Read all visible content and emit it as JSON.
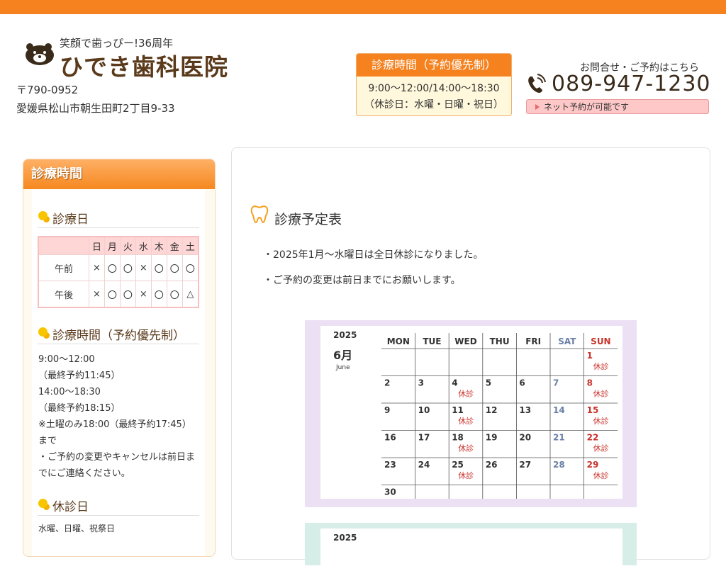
{
  "header": {
    "tagline": "笑顔で歯っぴー!36周年",
    "clinic_name": "ひでき歯科医院",
    "postal": "〒790-0952",
    "address": "愛媛県松山市朝生田町2丁目9-33",
    "hours_title": "診療時間（予約優先制）",
    "hours_line": "9:00〜12:00/14:00〜18:30",
    "closed_line": "（休診日：水曜・日曜・祝日）",
    "contact_label": "お問合せ・ご予約はこちら",
    "phone": "089-947-1230",
    "net_button": "ネット予約が可能です"
  },
  "sidebar": {
    "header": "診療時間",
    "days_title": "診療日",
    "table": {
      "head": [
        "",
        "日",
        "月",
        "火",
        "水",
        "木",
        "金",
        "土"
      ],
      "rows": [
        [
          "午前",
          "×",
          "〇",
          "〇",
          "×",
          "〇",
          "〇",
          "〇"
        ],
        [
          "午後",
          "×",
          "〇",
          "〇",
          "×",
          "〇",
          "〇",
          "△"
        ]
      ]
    },
    "hours_title": "診療時間（予約優先制）",
    "hours_lines": [
      "9:00〜12:00",
      "（最終予約11:45）",
      "14:00〜18:30",
      "（最終予約18:15）",
      "※土曜のみ18:00（最終予約17:45）",
      "まで",
      "・ご予約の変更やキャンセルは前日ま",
      "でにご連絡ください。"
    ],
    "closed_title": "休診日",
    "closed_text": "水曜、日曜、祝祭日"
  },
  "main": {
    "title": "診療予定表",
    "notes": [
      "・2025年1月〜水曜日は全日休診になりました。",
      "・ご予約の変更は前日までにお願いします。"
    ],
    "calendar": {
      "year": "2025",
      "month": "6月",
      "month_en": "June",
      "weekdays": [
        "MON",
        "TUE",
        "WED",
        "THU",
        "FRI",
        "SAT",
        "SUN"
      ],
      "weeks": [
        [
          "",
          "",
          "",
          "",
          "",
          "",
          "1"
        ],
        [
          "2",
          "3",
          "4",
          "5",
          "6",
          "7",
          "8"
        ],
        [
          "9",
          "10",
          "11",
          "12",
          "13",
          "14",
          "15"
        ],
        [
          "16",
          "17",
          "18",
          "19",
          "20",
          "21",
          "22"
        ],
        [
          "23",
          "24",
          "25",
          "26",
          "27",
          "28",
          "29"
        ],
        [
          "30",
          "",
          "",
          "",
          "",
          "",
          ""
        ]
      ],
      "closed_label": "休診",
      "closed_days": [
        "1",
        "4",
        "8",
        "11",
        "15",
        "18",
        "22",
        "25",
        "29"
      ],
      "colors": {
        "sat": "#6a7fa6",
        "sun": "#c8322a",
        "closed": "#c8322a"
      }
    },
    "calendar2": {
      "year": "2025"
    }
  }
}
